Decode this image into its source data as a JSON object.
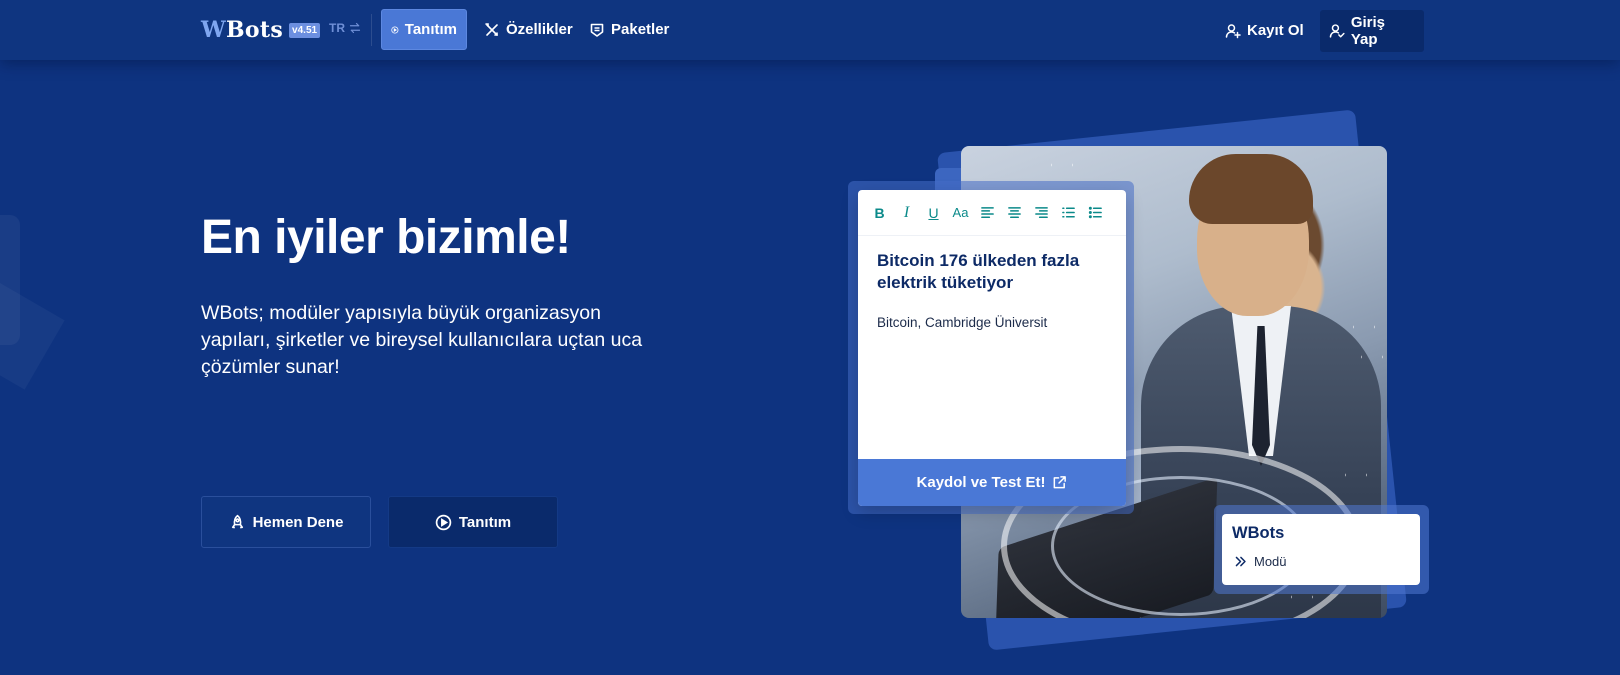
{
  "navbar": {
    "brand": {
      "initial": "W",
      "rest": "Bots",
      "version": "v4.51"
    },
    "language": "TR",
    "items": [
      {
        "label": "Tanıtım",
        "icon": "play-circle-icon",
        "active": true
      },
      {
        "label": "Özellikler",
        "icon": "tools-icon",
        "active": false
      },
      {
        "label": "Paketler",
        "icon": "package-icon",
        "active": false
      }
    ],
    "register_label": "Kayıt Ol",
    "login_label": "Giriş Yap"
  },
  "hero": {
    "title": "En iyiler bizimle!",
    "description": "WBots; modüler yapısıyla büyük organizasyon yapıları, şirketler ve bireysel kullanıcılara uçtan uca çözümler sunar!",
    "try_label": "Hemen Dene",
    "intro_label": "Tanıtım"
  },
  "editor": {
    "toolbar": [
      {
        "label": "B",
        "icon": "bold-icon"
      },
      {
        "label": "I",
        "icon": "italic-icon"
      },
      {
        "label": "U",
        "icon": "underline-icon"
      },
      {
        "label": "Aa",
        "icon": "font-size-icon"
      },
      {
        "label": "",
        "icon": "align-left-icon"
      },
      {
        "label": "",
        "icon": "align-center-icon"
      },
      {
        "label": "",
        "icon": "align-right-icon"
      },
      {
        "label": "",
        "icon": "ordered-list-icon"
      },
      {
        "label": "",
        "icon": "unordered-list-icon"
      }
    ],
    "headline": "Bitcoin 176 ülkeden fazla elektrik tüketiyor",
    "body": "Bitcoin, Cambridge Üniversit",
    "cta_label": "Kaydol ve Test Et!"
  },
  "module_card": {
    "title": "WBots",
    "subtitle": "Modü"
  },
  "colors": {
    "background": "#0e3380",
    "accent": "#4a78d6",
    "dark_button": "#0a2a6b",
    "editor_icon": "#0b8a8a",
    "card_title": "#0d2a66"
  }
}
